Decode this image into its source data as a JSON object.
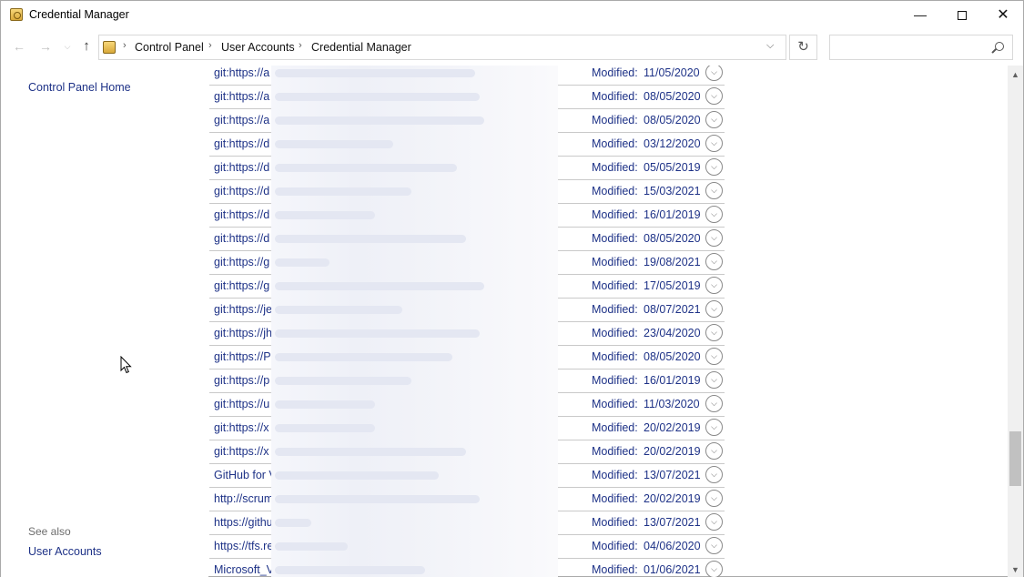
{
  "window": {
    "title": "Credential Manager",
    "controls": {
      "minimize": "—",
      "close": "✕"
    }
  },
  "nav": {
    "back": "←",
    "forward": "→",
    "recent": "⌵",
    "up": "↑",
    "breadcrumb": [
      "Control Panel",
      "User Accounts",
      "Credential Manager"
    ],
    "separator": "›",
    "dropdown": "⌵",
    "refresh": "↻",
    "search_placeholder": ""
  },
  "sidebar": {
    "home_link": "Control Panel Home",
    "see_also_label": "See also",
    "see_also_links": [
      "User Accounts"
    ]
  },
  "credentials": {
    "modified_label": "Modified:",
    "expand_glyph": "⌵",
    "items": [
      {
        "name": "git:https://a",
        "date": "11/05/2020"
      },
      {
        "name": "git:https://a",
        "date": "08/05/2020"
      },
      {
        "name": "git:https://a",
        "date": "08/05/2020"
      },
      {
        "name": "git:https://d",
        "date": "03/12/2020"
      },
      {
        "name": "git:https://d",
        "date": "05/05/2019"
      },
      {
        "name": "git:https://d",
        "date": "15/03/2021"
      },
      {
        "name": "git:https://d",
        "date": "16/01/2019"
      },
      {
        "name": "git:https://d",
        "date": "08/05/2020"
      },
      {
        "name": "git:https://g",
        "date": "19/08/2021"
      },
      {
        "name": "git:https://g",
        "date": "17/05/2019"
      },
      {
        "name": "git:https://je",
        "date": "08/07/2021"
      },
      {
        "name": "git:https://jh",
        "date": "23/04/2020"
      },
      {
        "name": "git:https://P",
        "date": "08/05/2020"
      },
      {
        "name": "git:https://p",
        "date": "16/01/2019"
      },
      {
        "name": "git:https://u",
        "date": "11/03/2020"
      },
      {
        "name": "git:https://x",
        "date": "20/02/2019"
      },
      {
        "name": "git:https://x",
        "date": "20/02/2019"
      },
      {
        "name": "GitHub for V",
        "date": "13/07/2021"
      },
      {
        "name": "http://scrum",
        "date": "20/02/2019"
      },
      {
        "name": "https://githu",
        "date": "13/07/2021"
      },
      {
        "name": "https://tfs.re",
        "date": "04/06/2020"
      },
      {
        "name": "Microsoft_V",
        "date": "01/06/2021"
      }
    ]
  },
  "scrollbar": {
    "up": "▲",
    "down": "▼",
    "position": 0.82
  }
}
